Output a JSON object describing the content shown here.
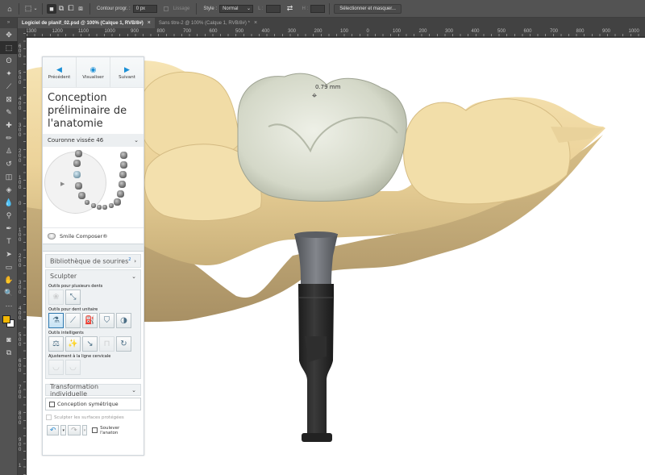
{
  "options_bar": {
    "tools": [
      {
        "name": "home-icon",
        "glyph": "⌂"
      },
      {
        "name": "marquee-tool-icon",
        "glyph": "⬚"
      },
      {
        "name": "chevron-down-icon",
        "glyph": "⌄"
      },
      {
        "name": "new-selection-icon",
        "glyph": "■"
      },
      {
        "name": "add-selection-icon",
        "glyph": "⧉"
      },
      {
        "name": "subtract-selection-icon",
        "glyph": "⧠"
      },
      {
        "name": "intersect-selection-icon",
        "glyph": "⧈"
      }
    ],
    "feather_label": "Contour progr. :",
    "feather_value": "0 px",
    "antialias_label": "Lissage",
    "style_label": "Style :",
    "style_value": "Normal",
    "width_label": "L :",
    "height_label": "H :",
    "swap_glyph": "⇄",
    "select_mask_button": "Sélectionner et masquer..."
  },
  "tabs": [
    {
      "label": "Logiciel de planif_02.psd @ 100% (Calque 1, RVB/8#)",
      "active": true,
      "close": "×"
    },
    {
      "label": "Sans titre-2 @ 100% (Calque 1, RVB/8#) *",
      "active": false,
      "close": "×"
    }
  ],
  "toolbar": {
    "collapse": "»",
    "tools": [
      {
        "name": "move-tool-icon",
        "glyph": "✥"
      },
      {
        "name": "marquee-tool-icon",
        "glyph": "⬚",
        "active": true
      },
      {
        "name": "lasso-tool-icon",
        "glyph": "ʘ"
      },
      {
        "name": "magic-wand-tool-icon",
        "glyph": "✦"
      },
      {
        "name": "crop-tool-icon",
        "glyph": "⟋"
      },
      {
        "name": "frame-tool-icon",
        "glyph": "⊠"
      },
      {
        "name": "eyedropper-tool-icon",
        "glyph": "✎"
      },
      {
        "name": "healing-brush-tool-icon",
        "glyph": "✚"
      },
      {
        "name": "brush-tool-icon",
        "glyph": "✏"
      },
      {
        "name": "clone-stamp-tool-icon",
        "glyph": "♙"
      },
      {
        "name": "history-brush-tool-icon",
        "glyph": "↺"
      },
      {
        "name": "eraser-tool-icon",
        "glyph": "◫"
      },
      {
        "name": "paint-bucket-tool-icon",
        "glyph": "◈"
      },
      {
        "name": "blur-tool-icon",
        "glyph": "💧"
      },
      {
        "name": "dodge-tool-icon",
        "glyph": "⚲"
      },
      {
        "name": "pen-tool-icon",
        "glyph": "✒"
      },
      {
        "name": "type-tool-icon",
        "glyph": "T"
      },
      {
        "name": "path-selection-tool-icon",
        "glyph": "➤"
      },
      {
        "name": "rectangle-tool-icon",
        "glyph": "▭"
      },
      {
        "name": "hand-tool-icon",
        "glyph": "✋"
      },
      {
        "name": "zoom-tool-icon",
        "glyph": "🔍"
      },
      {
        "name": "more-tools-icon",
        "glyph": "⋯"
      }
    ],
    "colors": {
      "foreground": "#f2b705",
      "background": "#ffffff"
    },
    "bottom_tools": [
      {
        "name": "quick-mask-icon",
        "glyph": "◙"
      },
      {
        "name": "screen-mode-icon",
        "glyph": "⧉"
      }
    ]
  },
  "ruler_top": [
    "1300",
    "1200",
    "1100",
    "1000",
    "900",
    "800",
    "700",
    "600",
    "500",
    "400",
    "300",
    "200",
    "100",
    "0",
    "100",
    "200",
    "300",
    "400",
    "500",
    "600",
    "700",
    "800",
    "900",
    "1000"
  ],
  "ruler_left": [
    "600",
    "500",
    "400",
    "300",
    "200",
    "100",
    "0",
    "100",
    "200",
    "300",
    "400",
    "500",
    "600",
    "700",
    "800",
    "900",
    "1"
  ],
  "panel": {
    "nav": [
      {
        "label": "Précédent",
        "icon": "◀",
        "name": "previous-button",
        "icon_name": "arrow-left-icon"
      },
      {
        "label": "Visualiser",
        "icon": "◉",
        "name": "visualize-button",
        "icon_name": "eye-icon"
      },
      {
        "label": "Suivant",
        "icon": "▶",
        "name": "next-button",
        "icon_name": "arrow-right-icon"
      }
    ],
    "title": "Conception préliminaire de l'anatomie",
    "crown_dropdown": "Couronne vissée 46",
    "smile_composer": "Smile Composer®",
    "smile_library": "Bibliothèque de sourires",
    "smile_library_badge": "2",
    "sculpt_header": "Sculpter",
    "multi_teeth_label": "Outils pour plusieurs dents",
    "multi_teeth_tools": [
      {
        "name": "multi-tooth-tool-1-icon",
        "glyph": "❀",
        "disabled": true
      },
      {
        "name": "multi-tooth-arc-tool-icon",
        "glyph": "⤡",
        "disabled": false
      }
    ],
    "single_tooth_label": "Outils pour dent unitaire",
    "single_tooth_tools": [
      {
        "name": "single-tooth-morph-tool-icon",
        "glyph": "⚗",
        "selected": true
      },
      {
        "name": "single-tooth-knife-tool-icon",
        "glyph": "⟋"
      },
      {
        "name": "single-tooth-wax-tool-icon",
        "glyph": "⛽"
      },
      {
        "name": "single-tooth-abutment-tool-icon",
        "glyph": "⛉"
      },
      {
        "name": "single-tooth-plane-tool-icon",
        "glyph": "◑"
      }
    ],
    "smart_tools_label": "Outils intelligents",
    "smart_tools": [
      {
        "name": "smart-contact-tool-icon",
        "glyph": "⚖"
      },
      {
        "name": "smart-magic-tool-icon",
        "glyph": "✨"
      },
      {
        "name": "smart-adapt-tool-icon",
        "glyph": "↘"
      },
      {
        "name": "smart-pontic-tool-icon",
        "glyph": "⊓",
        "disabled": true
      },
      {
        "name": "smart-reset-tool-icon",
        "glyph": "↻"
      }
    ],
    "cervical_label": "Ajustement à la ligne cervicale",
    "cervical_tools": [
      {
        "name": "cervical-tool-1-icon",
        "glyph": "◡",
        "disabled": true
      },
      {
        "name": "cervical-tool-2-icon",
        "glyph": "◡",
        "disabled": true
      }
    ],
    "transform_header": "Transformation individuelle",
    "symmetric_design": "Conception symétrique",
    "protected_surfaces": "Sculpter les surfaces protégées",
    "lift_antagonist": "Soulever l'anaton",
    "undo_glyph": "↶",
    "redo_glyph": "↷",
    "dropdown_glyph": "▾",
    "chevron_down": "⌄",
    "chevron_right": "›"
  },
  "viewport": {
    "measurement": "0.79 mm",
    "crosshair_glyph": "⌖",
    "colors": {
      "gingiva_model": "#f0d9a0",
      "crown": "#dfe3d6",
      "abutment": "#6b6e73",
      "scanbody": "#262626"
    }
  }
}
